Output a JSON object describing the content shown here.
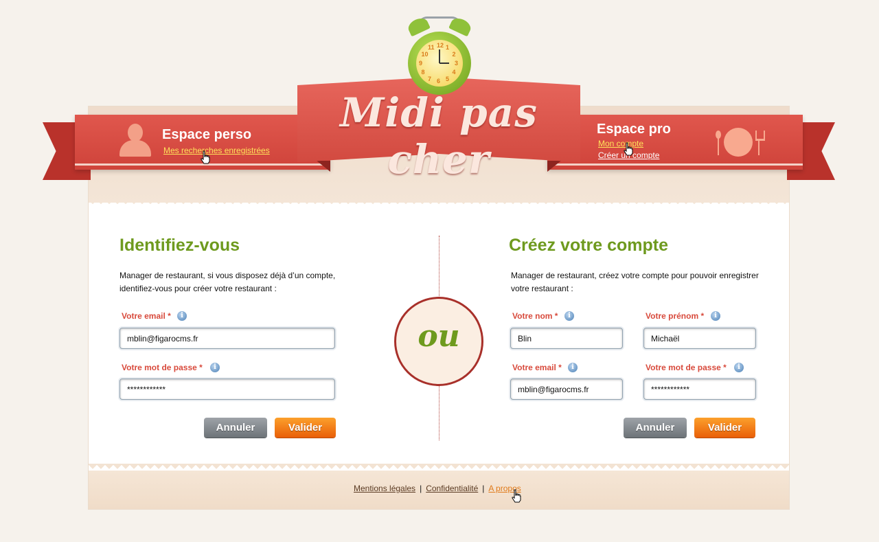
{
  "header": {
    "brand": "Midi pas cher",
    "left": {
      "title": "Espace perso",
      "link": "Mes recherches enregistrées"
    },
    "right": {
      "title": "Espace pro",
      "links": [
        "Mon compte",
        "Créer un compte"
      ]
    },
    "clock_numbers": [
      "12",
      "1",
      "2",
      "3",
      "4",
      "5",
      "6",
      "7",
      "8",
      "9",
      "10",
      "11"
    ]
  },
  "login": {
    "title": "Identifiez-vous",
    "intro_lines": [
      "Manager de restaurant, si vous disposez déjà d’un compte,",
      "identifiez-vous pour créer votre restaurant :"
    ],
    "email_label": "Votre email *",
    "email_value": "mblin@figarocms.fr",
    "password_label": "Votre mot de passe *",
    "password_value": "************",
    "cancel_label": "Annuler",
    "submit_label": "Valider"
  },
  "separator_word": "ou",
  "signup": {
    "title": "Créez votre compte",
    "intro_lines": [
      "Manager de restaurant, créez votre compte pour pouvoir enregistrer",
      "votre restaurant :"
    ],
    "lastname_label": "Votre nom *",
    "lastname_value": "Blin",
    "firstname_label": "Votre prénom *",
    "firstname_value": "Michaël",
    "email_label": "Votre email *",
    "email_value": "mblin@figarocms.fr",
    "password_label": "Votre mot de passe *",
    "password_value": "************",
    "cancel_label": "Annuler",
    "submit_label": "Valider"
  },
  "info_glyph": "i",
  "footer": {
    "links": [
      "Mentions légales",
      "Confidentialité",
      "A propos"
    ],
    "separator": "|"
  },
  "colors": {
    "ribbon_red": "#d84a40",
    "heading_green": "#6e9a1e",
    "label_red": "#d84a3c",
    "button_orange": "#f07a14",
    "button_grey": "#80868b"
  }
}
